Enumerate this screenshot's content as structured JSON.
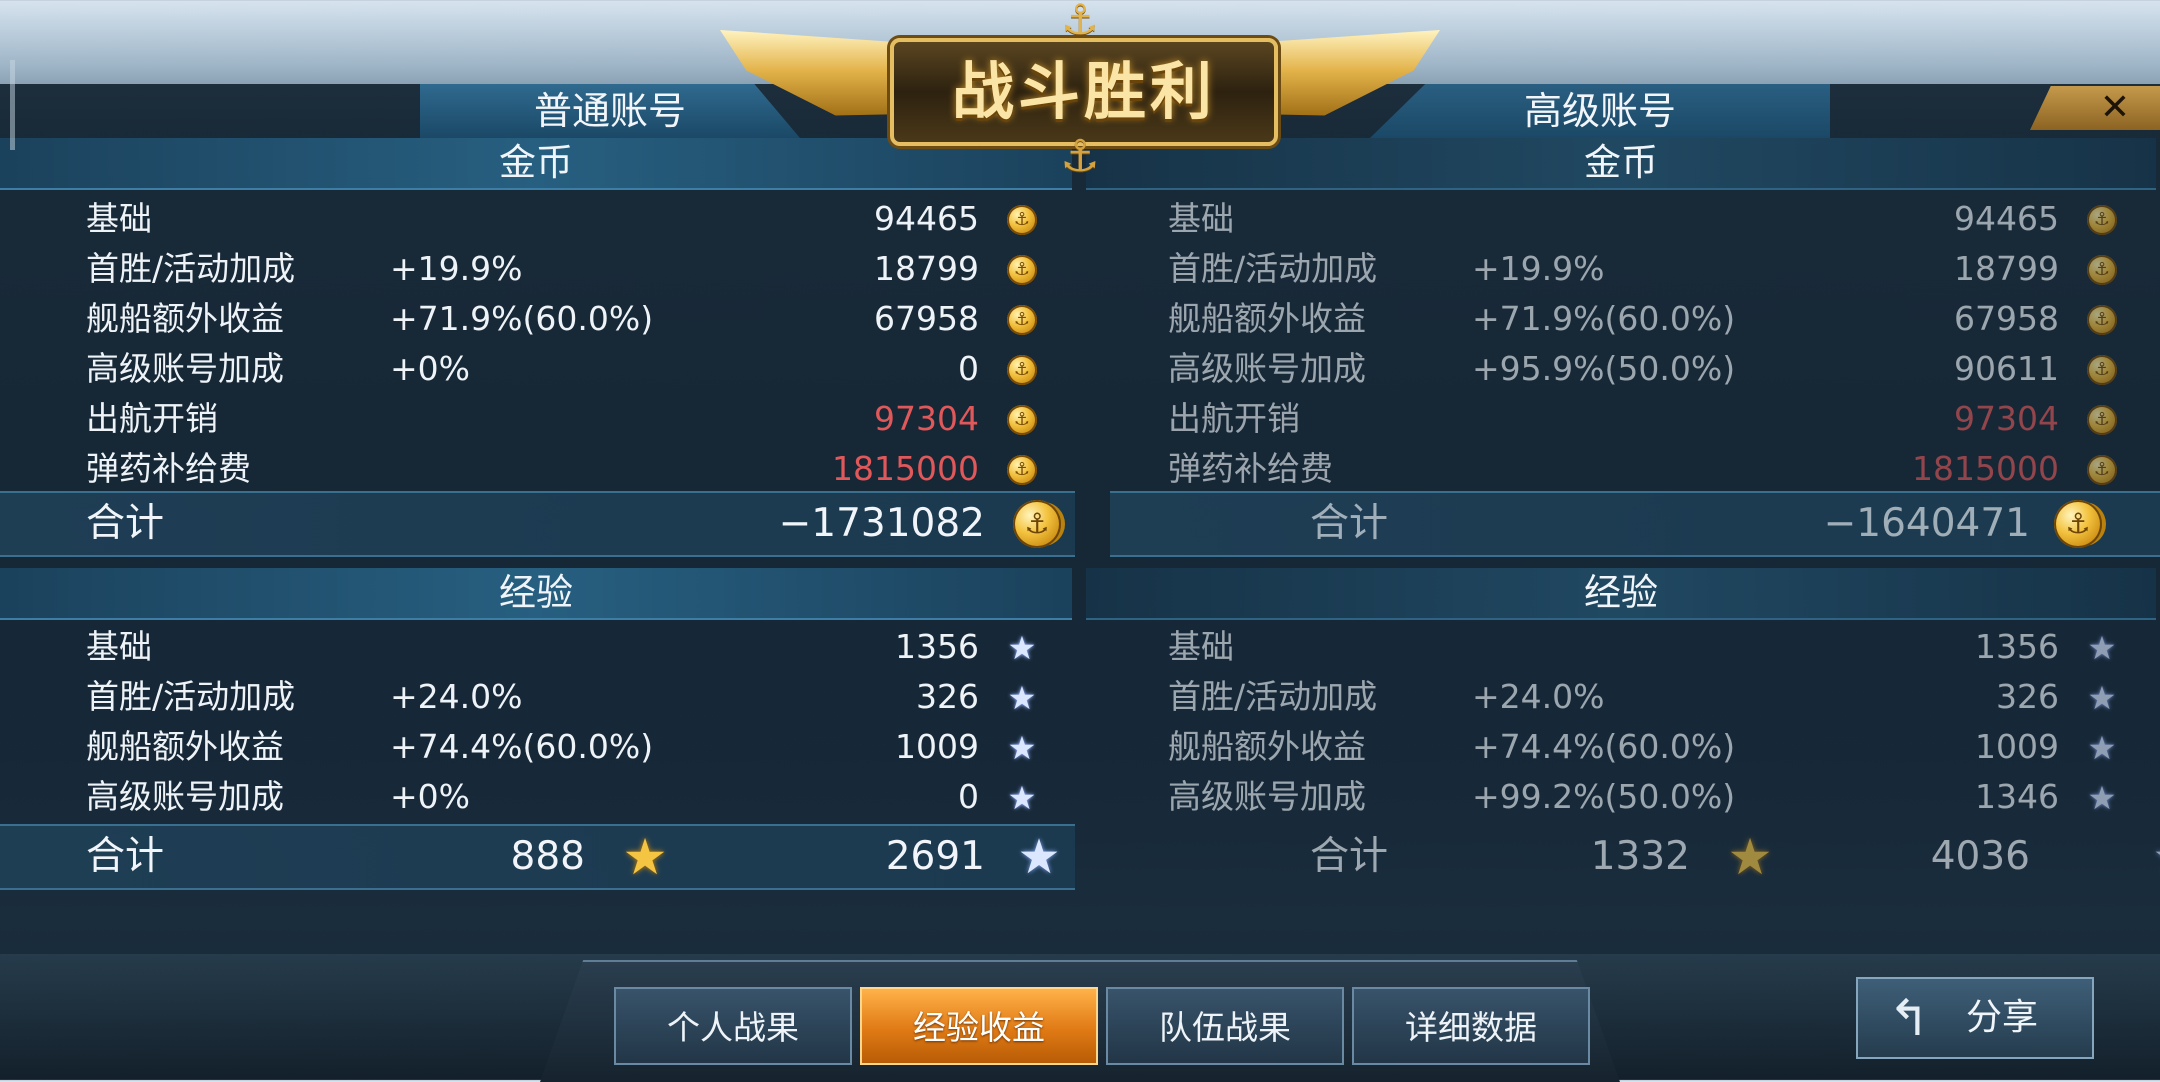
{
  "banner": {
    "title": "战斗胜利",
    "anchor_icon": "⚓"
  },
  "close": {
    "label": "✕"
  },
  "accounts": [
    {
      "name": "普通账号",
      "gold": {
        "header": "金币",
        "rows": [
          {
            "label": "基础",
            "pct": "",
            "value": "94465",
            "negative": false
          },
          {
            "label": "首胜/活动加成",
            "pct": "+19.9%",
            "value": "18799",
            "negative": false
          },
          {
            "label": "舰船额外收益",
            "pct": "+71.9%(60.0%)",
            "value": "67958",
            "negative": false
          },
          {
            "label": "高级账号加成",
            "pct": "+0%",
            "value": "0",
            "negative": false
          },
          {
            "label": "出航开销",
            "pct": "",
            "value": "97304",
            "negative": true
          },
          {
            "label": "弹药补给费",
            "pct": "",
            "value": "1815000",
            "negative": true
          }
        ],
        "total_label": "合计",
        "total_value": "−1731082"
      },
      "exp": {
        "header": "经验",
        "rows": [
          {
            "label": "基础",
            "pct": "",
            "value": "1356"
          },
          {
            "label": "首胜/活动加成",
            "pct": "+24.0%",
            "value": "326"
          },
          {
            "label": "舰船额外收益",
            "pct": "+74.4%(60.0%)",
            "value": "1009"
          },
          {
            "label": "高级账号加成",
            "pct": "+0%",
            "value": "0"
          }
        ],
        "total_label": "合计",
        "total_gold_value": "888",
        "total_value": "2691"
      }
    },
    {
      "name": "高级账号",
      "gold": {
        "header": "金币",
        "rows": [
          {
            "label": "基础",
            "pct": "",
            "value": "94465",
            "negative": false
          },
          {
            "label": "首胜/活动加成",
            "pct": "+19.9%",
            "value": "18799",
            "negative": false
          },
          {
            "label": "舰船额外收益",
            "pct": "+71.9%(60.0%)",
            "value": "67958",
            "negative": false
          },
          {
            "label": "高级账号加成",
            "pct": "+95.9%(50.0%)",
            "value": "90611",
            "negative": false
          },
          {
            "label": "出航开销",
            "pct": "",
            "value": "97304",
            "negative": true
          },
          {
            "label": "弹药补给费",
            "pct": "",
            "value": "1815000",
            "negative": true
          }
        ],
        "total_label": "合计",
        "total_value": "−1640471"
      },
      "exp": {
        "header": "经验",
        "rows": [
          {
            "label": "基础",
            "pct": "",
            "value": "1356"
          },
          {
            "label": "首胜/活动加成",
            "pct": "+24.0%",
            "value": "326"
          },
          {
            "label": "舰船额外收益",
            "pct": "+74.4%(60.0%)",
            "value": "1009"
          },
          {
            "label": "高级账号加成",
            "pct": "+99.2%(50.0%)",
            "value": "1346"
          }
        ],
        "total_label": "合计",
        "total_gold_value": "1332",
        "total_value": "4036"
      }
    }
  ],
  "tabs": [
    {
      "label": "个人战果",
      "active": false
    },
    {
      "label": "经验收益",
      "active": true
    },
    {
      "label": "队伍战果",
      "active": false
    },
    {
      "label": "详细数据",
      "active": false
    }
  ],
  "share": {
    "label": "分享",
    "icon": "↰"
  },
  "icons": {
    "coin": "⚓",
    "star": "★"
  },
  "colors": {
    "negative": "#e0585a",
    "active_tab": "#e07a15",
    "gold": "#f3c542"
  }
}
